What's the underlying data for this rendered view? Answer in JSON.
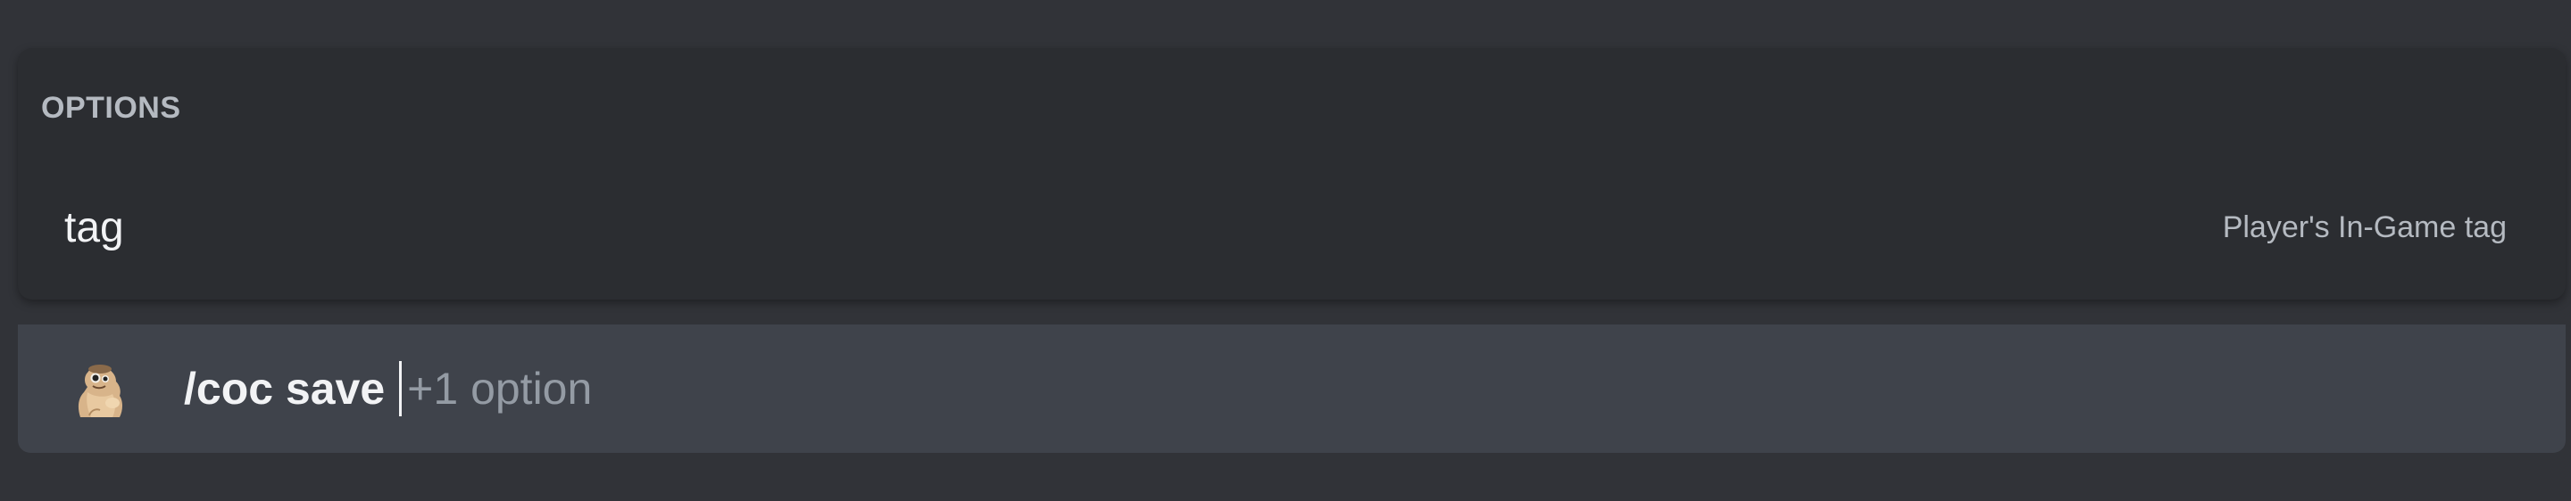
{
  "options_panel": {
    "header": "OPTIONS",
    "items": [
      {
        "name": "tag",
        "description": "Player's In-Game tag"
      }
    ]
  },
  "command_bar": {
    "avatar_icon": "bot-avatar-icon",
    "command": "/coc save",
    "hint": "+1 option"
  },
  "colors": {
    "page_background": "#313338",
    "panel_background": "#2b2d31",
    "command_bar_background": "#3f434b",
    "primary_text": "#f2f3f5",
    "muted_text": "#b5bac1"
  }
}
